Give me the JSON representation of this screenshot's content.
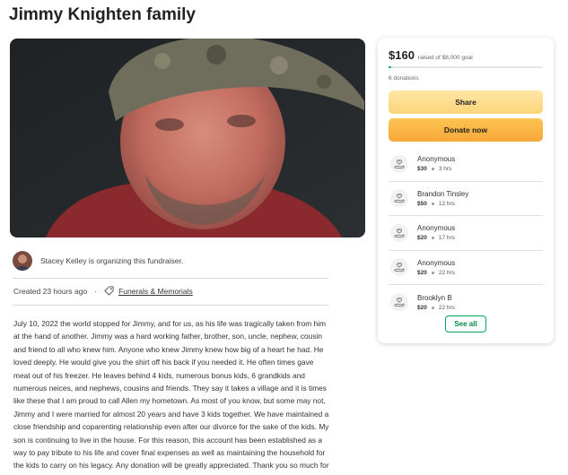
{
  "page": {
    "title": "Jimmy Knighten family"
  },
  "organizer": {
    "text": "Stacey Kelley is organizing this fundraiser."
  },
  "meta": {
    "created": "Created 23 hours ago",
    "category": "Funerals & Memorials",
    "category_icon": "tag-icon"
  },
  "story": {
    "text": "July 10, 2022 the world stopped for Jimmy, and for us, as his life was tragically taken from him at the hand of another. Jimmy was a hard working father, brother, son, uncle, nephew, cousin and friend to all who knew him. Anyone who knew Jimmy knew how big of a heart he had. He loved deeply. He would give you the shirt off his back if you needed it. He often times gave meat out of his freezer. He leaves behind 4 kids, numerous bonus kids, 6 grandkids and numerous neices, and nephews, cousins and friends. They say it takes a village and it is times like these that I am proud to call Allen my hometown. As most of you know, but some may not, Jimmy and I were married for almost 20 years and have 3 kids together. We have maintained a close friendship and coparenting relationship even after our divorce for the sake of the kids. My son is continuing to live in the house. For this reason, this account has been established as a way to pay tribute to his life and cover final expenses as well as maintaining the household for the kids to carry on his legacy. Any donation will be greatly appreciated. Thank you so much for your outpouring of support during this most difficult of times! I appreciate you all!! ❤❤"
  },
  "donation_card": {
    "raised": "$160",
    "goal_text": "raised of $8,000 goal",
    "progress_fraction": 0.02,
    "donation_count": "6 donations",
    "share_label": "Share",
    "donate_label": "Donate now",
    "see_all_label": "See all",
    "donor_icon": "heart-hand-icon",
    "donors": [
      {
        "name": "Anonymous",
        "amount": "$30",
        "time": "3 hrs"
      },
      {
        "name": "Brandon Tinsley",
        "amount": "$50",
        "time": "12 hrs"
      },
      {
        "name": "Anonymous",
        "amount": "$20",
        "time": "17 hrs"
      },
      {
        "name": "Anonymous",
        "amount": "$20",
        "time": "22 hrs"
      },
      {
        "name": "Brooklyn B",
        "amount": "$20",
        "time": "22 hrs"
      }
    ]
  },
  "colors": {
    "accent_green": "#02a95c",
    "share_yellow": "#fdd57a",
    "donate_orange": "#f7a83a"
  }
}
